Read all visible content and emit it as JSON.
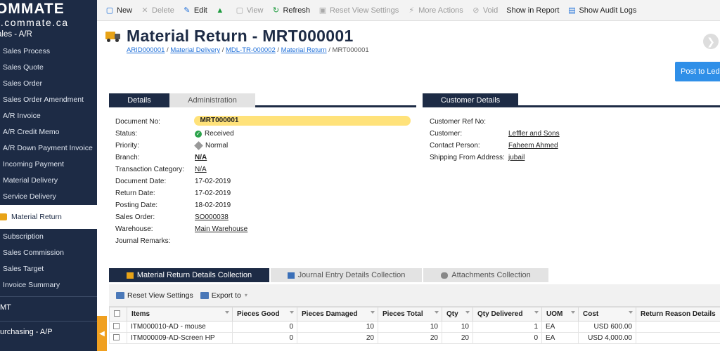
{
  "sidebar": {
    "brand": "OMMATE",
    "domain": "w.commate.ca",
    "module": "ales - A/R",
    "items": [
      {
        "label": "Sales Process"
      },
      {
        "label": "Sales Quote"
      },
      {
        "label": "Sales Order"
      },
      {
        "label": "Sales Order Amendment"
      },
      {
        "label": "A/R Invoice"
      },
      {
        "label": "A/R Credit Memo"
      },
      {
        "label": "A/R Down Payment Invoice"
      },
      {
        "label": "Incoming Payment"
      },
      {
        "label": "Material Delivery"
      },
      {
        "label": "Service Delivery"
      },
      {
        "label": "Material Return",
        "active": true
      },
      {
        "label": "Subscription"
      },
      {
        "label": "Sales Commission"
      },
      {
        "label": "Sales Target"
      },
      {
        "label": "Invoice Summary"
      }
    ],
    "groups": [
      {
        "label": "MT"
      },
      {
        "label": "urchasing - A/P"
      }
    ],
    "collapse_glyph": "◀"
  },
  "toolbar": {
    "new": "New",
    "delete": "Delete",
    "edit": "Edit",
    "view": "View",
    "refresh": "Refresh",
    "reset_view": "Reset View Settings",
    "more_actions": "More Actions",
    "void": "Void",
    "show_in_report": "Show in Report",
    "show_audit_logs": "Show Audit Logs"
  },
  "header": {
    "title": "Material Return - MRT000001",
    "breadcrumb": [
      {
        "label": "ARID000001"
      },
      {
        "label": "Material Delivery"
      },
      {
        "label": "MDL-TR-000002"
      },
      {
        "label": "Material Return"
      }
    ],
    "breadcrumb_current": "MRT000001",
    "post_button": "Post to Led"
  },
  "tabs": {
    "details": "Details",
    "administration": "Administration",
    "customer_details": "Customer Details"
  },
  "details": {
    "document_no_label": "Document No:",
    "document_no": "MRT000001",
    "status_label": "Status:",
    "status": "Received",
    "priority_label": "Priority:",
    "priority": "Normal",
    "branch_label": "Branch:",
    "branch": "N/A",
    "transaction_category_label": "Transaction Category:",
    "transaction_category": "N/A",
    "document_date_label": "Document Date:",
    "document_date": "17-02-2019",
    "return_date_label": "Return Date:",
    "return_date": "17-02-2019",
    "posting_date_label": "Posting Date:",
    "posting_date": "18-02-2019",
    "sales_order_label": "Sales Order:",
    "sales_order": "SO000038",
    "warehouse_label": "Warehouse:",
    "warehouse": "Main Warehouse",
    "journal_remarks_label": "Journal Remarks:",
    "journal_remarks": ""
  },
  "customer": {
    "ref_no_label": "Customer Ref No:",
    "ref_no": "",
    "customer_label": "Customer:",
    "customer": "Leffler and Sons",
    "contact_label": "Contact Person:",
    "contact": "Faheem Ahmed",
    "shipping_label": "Shipping From Address:",
    "shipping": "jubail"
  },
  "bottom_tabs": {
    "details_collection": "Material Return Details Collection",
    "journal_collection": "Journal Entry Details Collection",
    "attachments_collection": "Attachments Collection"
  },
  "sub_toolbar": {
    "reset_view": "Reset View Settings",
    "export": "Export to"
  },
  "grid": {
    "columns": [
      "Items",
      "Pieces Good",
      "Pieces Damaged",
      "Pieces Total",
      "Qty",
      "Qty Delivered",
      "UOM",
      "Cost",
      "Return Reason Details"
    ],
    "rows": [
      {
        "item": "ITM000010-AD - mouse",
        "good": "0",
        "damaged": "10",
        "total": "10",
        "qty": "10",
        "delivered": "1",
        "uom": "EA",
        "cost": "USD 600.00",
        "reason": ""
      },
      {
        "item": "ITM000009-AD-Screen HP",
        "good": "0",
        "damaged": "20",
        "total": "20",
        "qty": "20",
        "delivered": "0",
        "uom": "EA",
        "cost": "USD 4,000.00",
        "reason": ""
      }
    ]
  },
  "colors": {
    "sidebar_bg": "#1d2b45",
    "accent": "#2f8fe8",
    "highlight": "#ffe27a",
    "status_green": "#2aa24a"
  }
}
